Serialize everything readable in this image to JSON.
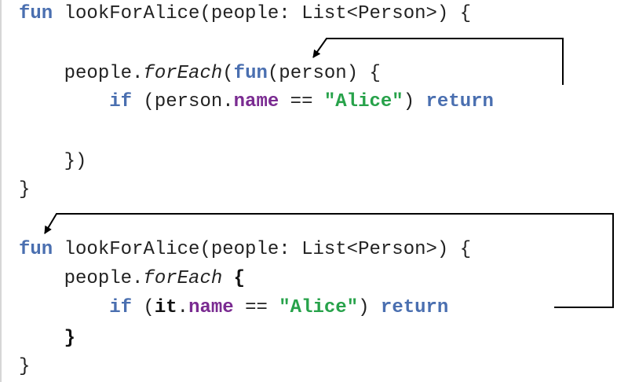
{
  "colors": {
    "keyword": "#4a6fb0",
    "property": "#7a2b91",
    "string": "#27a24a",
    "text": "#222222",
    "arrow": "#000000"
  },
  "snippet_1": {
    "line1": {
      "kw_fun": "fun",
      "sig": " lookForAlice(people: List<Person>) {"
    },
    "line2": {
      "indent": "    ",
      "recv": "people.",
      "forEach": "forEach",
      "open": "(",
      "kw_fun": "fun",
      "param": "(person) {"
    },
    "line3": {
      "indent": "        ",
      "kw_if": "if",
      "open": " (person.",
      "prop": "name",
      "eq": " == ",
      "str": "\"Alice\"",
      "close": ") ",
      "kw_return": "return"
    },
    "line4": {
      "indent": "    ",
      "text": "})"
    },
    "line5": {
      "text": "}"
    }
  },
  "snippet_2": {
    "line1": {
      "kw_fun": "fun",
      "sig": " lookForAlice(people: List<Person>) {"
    },
    "line2": {
      "indent": "    ",
      "recv": "people.",
      "forEach": "forEach",
      "space": " ",
      "brace": "{"
    },
    "line3": {
      "indent": "        ",
      "kw_if": "if",
      "open": " (",
      "it": "it",
      "dot": ".",
      "prop": "name",
      "eq": " == ",
      "str": "\"Alice\"",
      "close": ") ",
      "kw_return": "return"
    },
    "line4": {
      "indent": "    ",
      "brace": "}"
    },
    "line5": {
      "text": "}"
    }
  }
}
